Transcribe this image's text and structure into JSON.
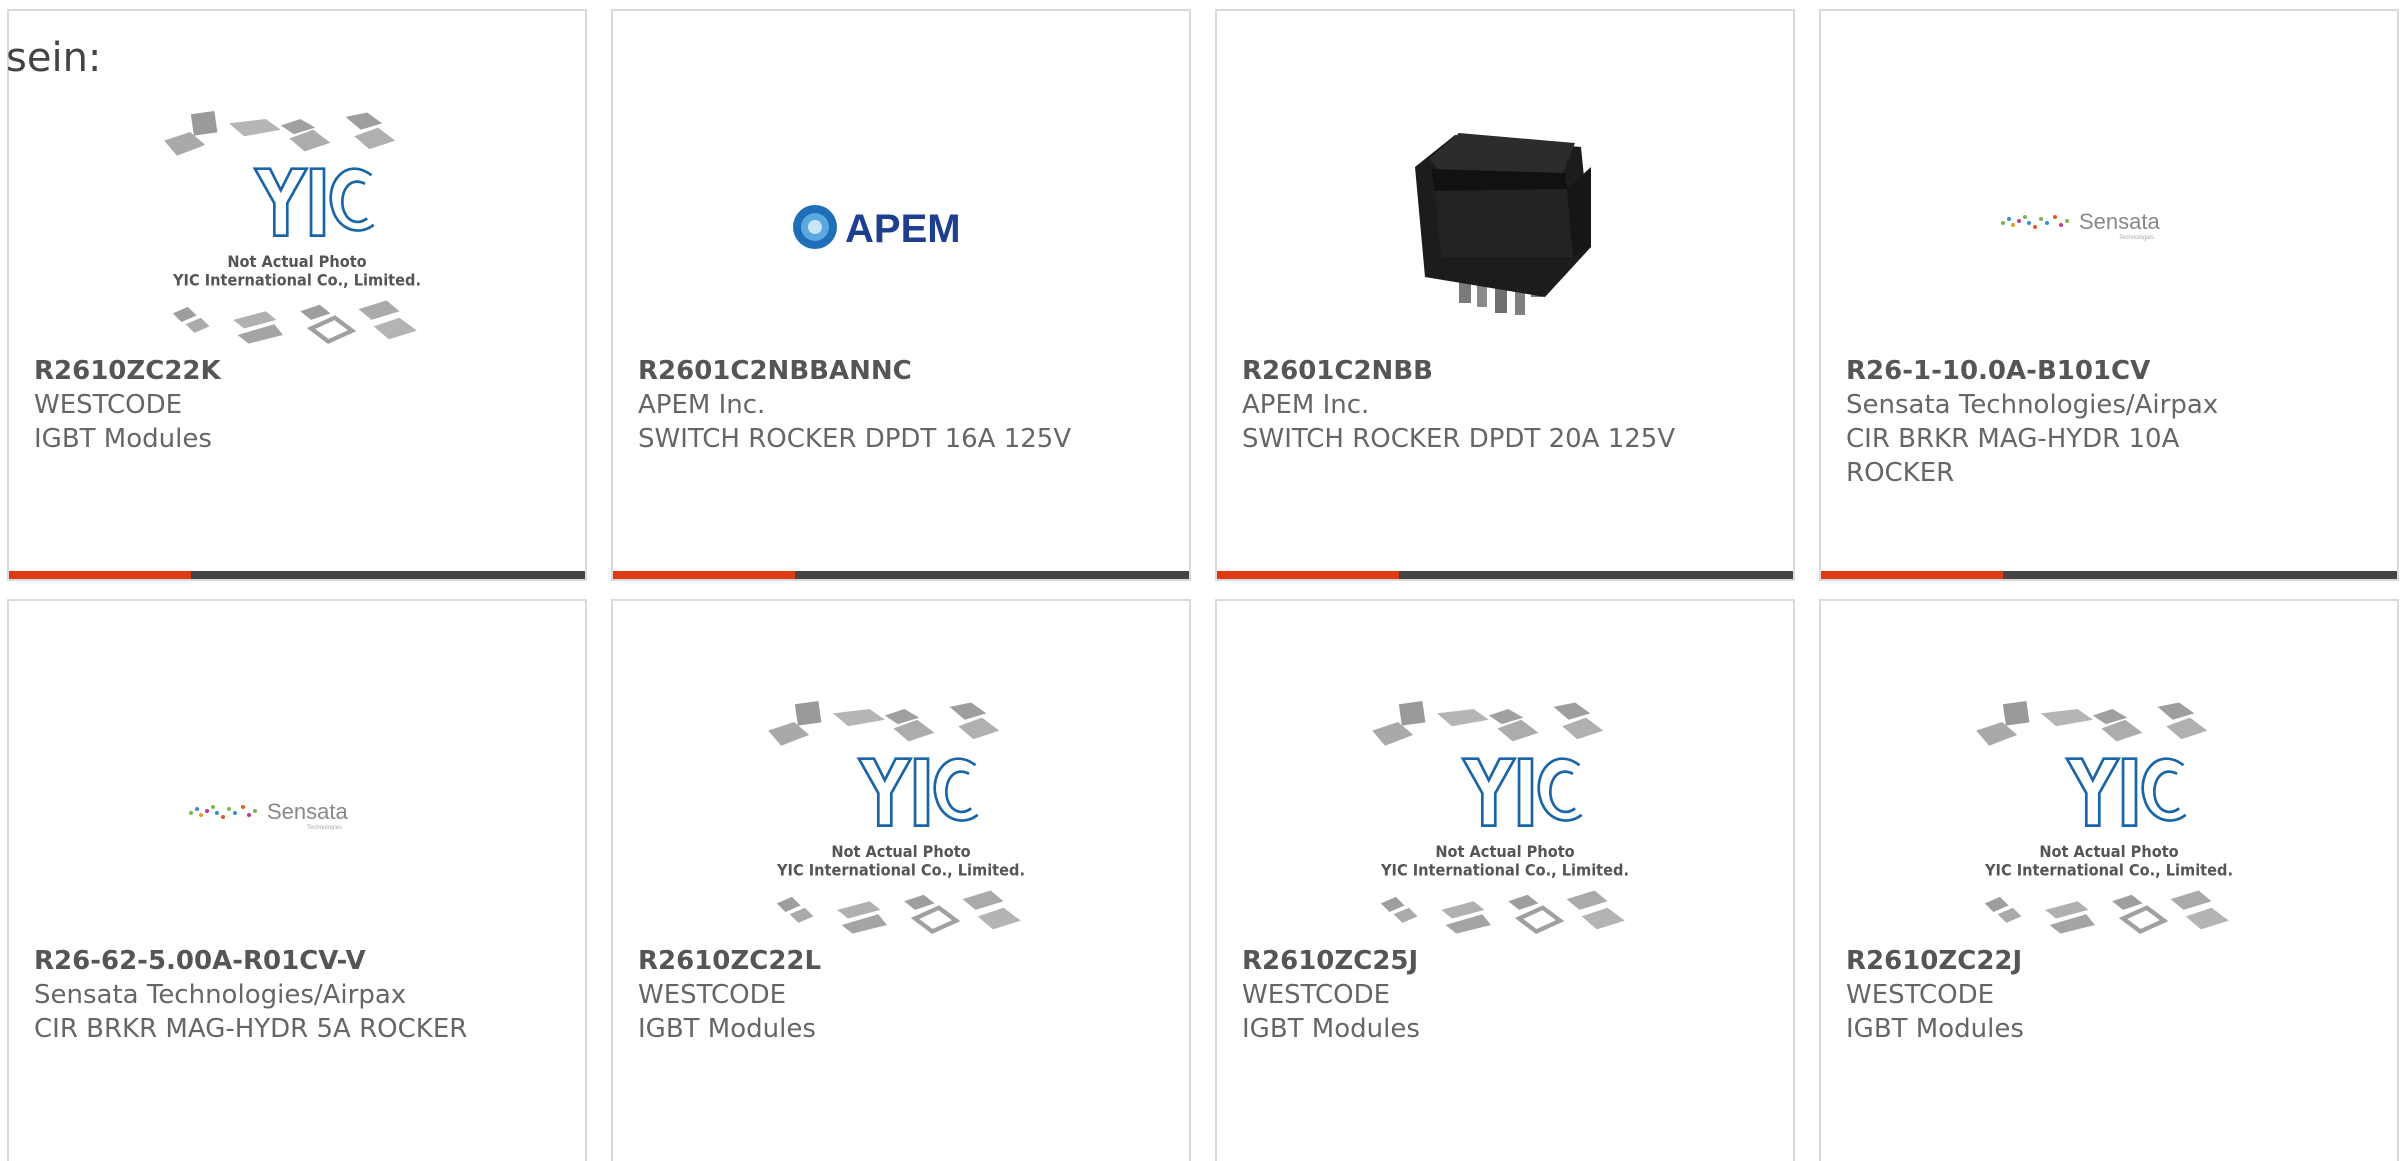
{
  "intro_text": "sein:",
  "colors": {
    "accent": "#e03a12",
    "bar": "#444444",
    "apem_blue": "#1e3f8f"
  },
  "placeholder": {
    "line1": "Not Actual Photo",
    "line2": "YIC International Co., Limited."
  },
  "logos": {
    "apem": "APEM",
    "sensata": "Sensata",
    "sensata_sub": "Technologies"
  },
  "products": [
    {
      "part": "R2610ZC22K",
      "maker": "WESTCODE",
      "desc": "IGBT Modules",
      "image": "placeholder-image"
    },
    {
      "part": "R2601C2NBBANNC",
      "maker": "APEM Inc.",
      "desc": "SWITCH ROCKER DPDT 16A 125V",
      "image": "apem-logo"
    },
    {
      "part": "R2601C2NBB",
      "maker": "APEM Inc.",
      "desc": "SWITCH ROCKER DPDT 20A 125V",
      "image": "rocker-switch-photo"
    },
    {
      "part": "R26-1-10.0A-B101CV",
      "maker": "Sensata Technologies/Airpax",
      "desc": "CIR BRKR MAG-HYDR 10A ROCKER",
      "image": "sensata-logo"
    },
    {
      "part": "R26-62-5.00A-R01CV-V",
      "maker": "Sensata Technologies/Airpax",
      "desc": "CIR BRKR MAG-HYDR 5A ROCKER",
      "image": "sensata-logo"
    },
    {
      "part": "R2610ZC22L",
      "maker": "WESTCODE",
      "desc": "IGBT Modules",
      "image": "placeholder-image"
    },
    {
      "part": "R2610ZC25J",
      "maker": "WESTCODE",
      "desc": "IGBT Modules",
      "image": "placeholder-image"
    },
    {
      "part": "R2610ZC22J",
      "maker": "WESTCODE",
      "desc": "IGBT Modules",
      "image": "placeholder-image"
    }
  ]
}
